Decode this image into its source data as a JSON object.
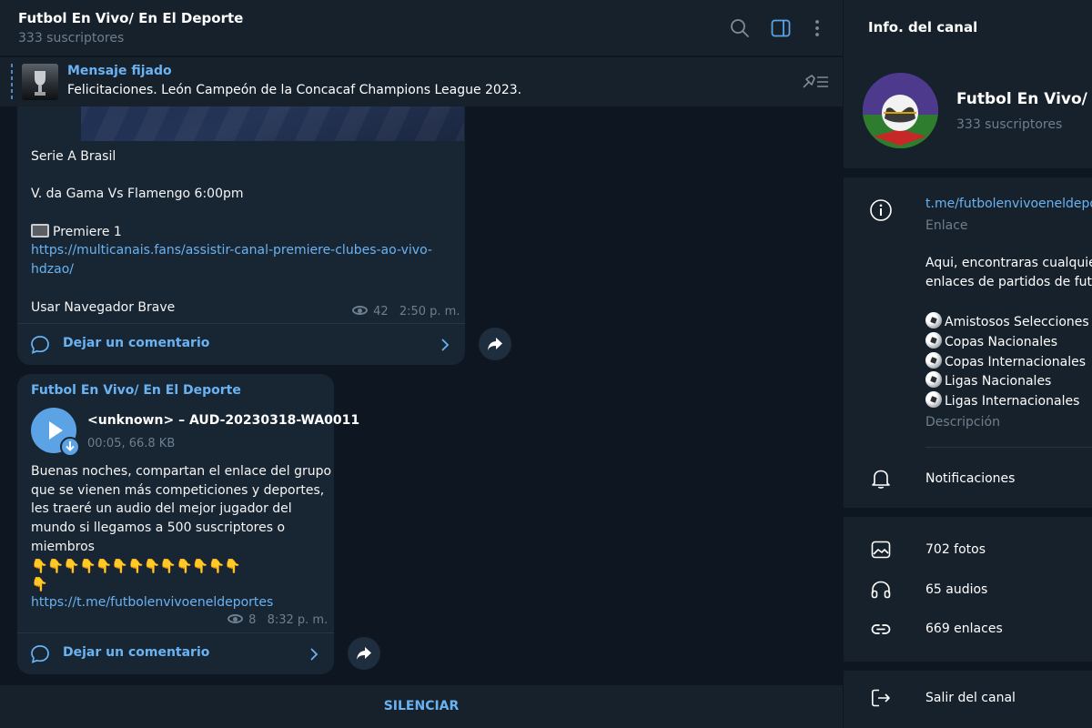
{
  "header": {
    "title": "Futbol En Vivo/ En El Deporte",
    "subscribers": "333 suscriptores"
  },
  "pinned": {
    "label": "Mensaje fijado",
    "text": "Felicitaciones. León Campeón de la Concacaf Champions League 2023."
  },
  "messages": [
    {
      "lines": [
        "Serie A Brasil",
        "",
        "V. da Gama Vs Flamengo 6:00pm",
        "",
        "Premiere 1"
      ],
      "link_lines": [
        "https://multicanais.fans/assistir-canal-premiere-clubes-ao-vivo-",
        "hdzao/"
      ],
      "footer": "Usar Navegador Brave",
      "views": "42",
      "time": "2:50 p. m.",
      "comment_label": "Dejar un comentario"
    },
    {
      "author": "Futbol En Vivo/ En El Deporte",
      "audio_title": "<unknown> – AUD-20230318-WA0011",
      "audio_meta": "00:05, 66.8 KB",
      "text_lines": [
        "Buenas noches, compartan el enlace del grupo",
        "que se vienen más competiciones y deportes,",
        "les traeré un audio del mejor jugador del",
        "mundo si llegamos a 500 suscriptores o",
        "miembros"
      ],
      "emoji_row": "👇👇👇👇👇👇👇👇👇👇👇👇👇",
      "emoji_row2": "👇",
      "link": "https://t.me/futbolenvivoeneldeportes",
      "views": "8",
      "time": "8:32 p. m.",
      "comment_label": "Dejar un comentario"
    }
  ],
  "bottom": {
    "mute_label": "SILENCIAR"
  },
  "info": {
    "title": "Info. del canal",
    "name": "Futbol En Vivo/ En El Deporte",
    "subscribers": "333 suscriptores",
    "link": "t.me/futbolenvivoeneldeportes",
    "link_label": "Enlace",
    "description_lines": [
      "Aqui, encontraras cualquier tipo de",
      "enlaces de partidos de futbol"
    ],
    "categories": [
      "Amistosos Selecciones",
      "Copas Nacionales",
      "Copas Internacionales",
      "Ligas Nacionales",
      "Ligas Internacionales"
    ],
    "description_label": "Descripción",
    "notifications_label": "Notificaciones",
    "photos": "702 fotos",
    "audios": "65 audios",
    "links": "669 enlaces",
    "leave": "Salir del canal"
  },
  "colors": {
    "accent": "#6ab3f3",
    "bubble": "#182533",
    "panel": "#17212b",
    "background": "#0e1621"
  }
}
